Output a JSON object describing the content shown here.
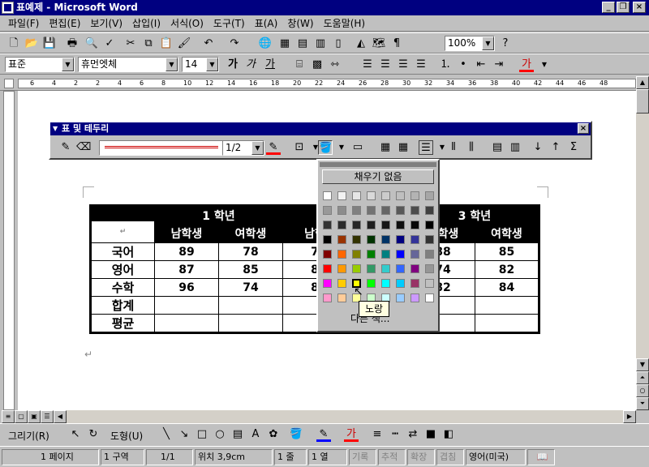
{
  "window": {
    "title": "표예제 - Microsoft Word"
  },
  "menu": [
    "파일(F)",
    "편집(E)",
    "보기(V)",
    "삽입(I)",
    "서식(O)",
    "도구(T)",
    "표(A)",
    "창(W)",
    "도움말(H)"
  ],
  "standard_toolbar": {
    "zoom": "100%"
  },
  "format_toolbar": {
    "style": "표준",
    "font": "휴먼엣체",
    "size": "14"
  },
  "ruler_ticks": [
    "6",
    "4",
    "2",
    "2",
    "4",
    "6",
    "8",
    "10",
    "12",
    "14",
    "16",
    "18",
    "20",
    "22",
    "24",
    "26",
    "28",
    "30",
    "32",
    "34",
    "36",
    "38",
    "40",
    "42",
    "44",
    "46",
    "48"
  ],
  "tables_borders_toolbar": {
    "title": "표 및 테두리",
    "line_weight": "1/2"
  },
  "table": {
    "grade1": "1 학년",
    "grade3": "3 학년",
    "subheaders": [
      "남학생",
      "여학생",
      "남학",
      "",
      "",
      "남학생",
      "여학생"
    ],
    "rows": [
      {
        "label": "국어",
        "cells": [
          "89",
          "78",
          "7",
          "",
          "88",
          "85"
        ]
      },
      {
        "label": "영어",
        "cells": [
          "87",
          "85",
          "8",
          "",
          "74",
          "82"
        ]
      },
      {
        "label": "수학",
        "cells": [
          "96",
          "74",
          "8",
          "",
          "82",
          "84"
        ]
      },
      {
        "label": "합계",
        "cells": [
          "",
          "",
          "",
          "",
          "",
          ""
        ]
      },
      {
        "label": "평균",
        "cells": [
          "",
          "",
          "",
          "",
          "",
          ""
        ]
      }
    ]
  },
  "fill_popup": {
    "no_fill": "채우기 없음",
    "more_colors": "다른 색...",
    "tooltip": "노랑",
    "colors": [
      [
        "#ffffff",
        "#f2f2f2",
        "#e6e6e6",
        "#d9d9d9",
        "#cccccc",
        "#bfbfbf",
        "#b3b3b3",
        "#a6a6a6"
      ],
      [
        "#999999",
        "#8c8c8c",
        "#808080",
        "#737373",
        "#666666",
        "#595959",
        "#4d4d4d",
        "#404040"
      ],
      [
        "#333333",
        "#2b2b2b",
        "#262626",
        "#1f1f1f",
        "#171717",
        "#0f0f0f",
        "#080808",
        "#000000"
      ],
      [
        "#000000",
        "#993300",
        "#333300",
        "#003300",
        "#003366",
        "#000080",
        "#333399",
        "#333333"
      ],
      [
        "#800000",
        "#ff6600",
        "#808000",
        "#008000",
        "#008080",
        "#0000ff",
        "#666699",
        "#808080"
      ],
      [
        "#ff0000",
        "#ff9900",
        "#99cc00",
        "#339966",
        "#33cccc",
        "#3366ff",
        "#800080",
        "#969696"
      ],
      [
        "#ff00ff",
        "#ffcc00",
        "#ffff00",
        "#00ff00",
        "#00ffff",
        "#00ccff",
        "#993366",
        "#c0c0c0"
      ],
      [
        "#ff99cc",
        "#ffcc99",
        "#ffff99",
        "#ccffcc",
        "#ccffff",
        "#99ccff",
        "#cc99ff",
        "#ffffff"
      ]
    ]
  },
  "drawing_toolbar": {
    "draw": "그리기(R)",
    "autoshapes": "도형(U)"
  },
  "status": {
    "page": "1 페이지",
    "section": "1 구역",
    "pages": "1/1",
    "position": "위치 3,9cm",
    "line": "1 줄",
    "col": "1 열",
    "rec": "기록",
    "trk": "추적",
    "ext": "확장",
    "ovr": "겹침",
    "lang": "영어(미국)"
  }
}
